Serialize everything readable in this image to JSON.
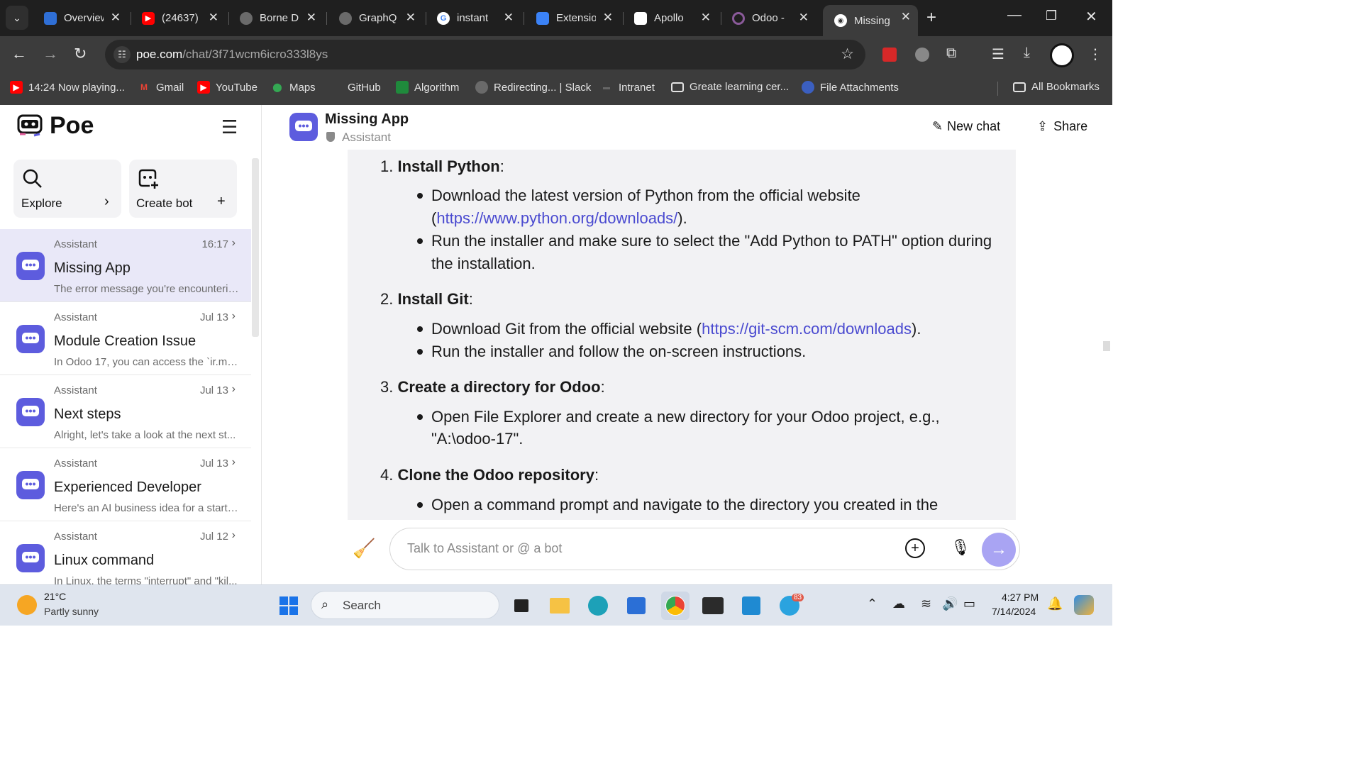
{
  "browser": {
    "tabs": [
      {
        "title": "Overview",
        "icon": "azure-devops-icon",
        "color": "#2f6fd6"
      },
      {
        "title": "(24637)",
        "icon": "youtube-icon",
        "color": "#ff0000"
      },
      {
        "title": "Borne D",
        "icon": "globe-icon",
        "color": "#7a7a7a"
      },
      {
        "title": "GraphQ",
        "icon": "globe-icon",
        "color": "#7a7a7a"
      },
      {
        "title": "instant",
        "icon": "google-icon",
        "color": "#ffffff"
      },
      {
        "title": "Extensio",
        "icon": "puzzle-icon",
        "color": "#3b82f6"
      },
      {
        "title": "Apollo",
        "icon": "apollo-icon",
        "color": "#ffffff"
      },
      {
        "title": "Odoo -",
        "icon": "odoo-icon",
        "color": "#8a5a9a"
      },
      {
        "title": "Missing",
        "icon": "poe-icon",
        "color": "#ffffff",
        "active": true
      }
    ],
    "url_domain": "poe.com",
    "url_path": "/chat/3f71wcm6icro333l8ys",
    "bookmarks": [
      {
        "label": "14:24 Now playing...",
        "icon": "youtube-icon"
      },
      {
        "label": "Gmail",
        "icon": "gmail-icon"
      },
      {
        "label": "YouTube",
        "icon": "youtube-icon"
      },
      {
        "label": "Maps",
        "icon": "maps-icon"
      },
      {
        "label": "GitHub",
        "icon": "github-icon"
      },
      {
        "label": "Algorithm",
        "icon": "algorithm-icon"
      },
      {
        "label": "Redirecting... | Slack",
        "icon": "globe-icon"
      },
      {
        "label": "Intranet",
        "icon": "intranet-icon"
      },
      {
        "label": "Greate learning cer...",
        "icon": "folder-icon"
      },
      {
        "label": "File Attachments",
        "icon": "globe-icon"
      }
    ],
    "all_bookmarks": "All Bookmarks"
  },
  "sidebar": {
    "logo": "Poe",
    "explore": "Explore",
    "create_bot": "Create bot",
    "conversations": [
      {
        "who": "Assistant",
        "time": "16:17",
        "name": "Missing App",
        "preview": "The error message you're encounterin..."
      },
      {
        "who": "Assistant",
        "time": "Jul 13",
        "name": "Module Creation Issue",
        "preview": "In Odoo 17, you can access the `ir.mo..."
      },
      {
        "who": "Assistant",
        "time": "Jul 13",
        "name": "Next steps",
        "preview": "Alright, let's take a look at the next st..."
      },
      {
        "who": "Assistant",
        "time": "Jul 13",
        "name": "Experienced Developer",
        "preview": "Here's an AI business idea for a startu..."
      },
      {
        "who": "Assistant",
        "time": "Jul 12",
        "name": "Linux command",
        "preview": "In Linux, the terms \"interrupt\" and \"kil..."
      }
    ]
  },
  "chat": {
    "title": "Missing App",
    "subtitle": "Assistant",
    "new_chat": "New chat",
    "share": "Share",
    "steps": [
      {
        "num": "1.",
        "title": "Install Python",
        "bullets": [
          {
            "lines": [
              "Download the latest version of Python from the official website",
              "(",
              "https://www.python.org/downloads/",
              ")."
            ]
          },
          {
            "lines": [
              "Run the installer and make sure to select the \"Add Python to PATH\" option during",
              "the installation."
            ]
          }
        ]
      },
      {
        "num": "2.",
        "title": "Install Git",
        "bullets": [
          {
            "lines": [
              "Download Git from the official website (",
              "https://git-scm.com/downloads",
              ")."
            ]
          },
          {
            "lines": [
              "Run the installer and follow the on-screen instructions."
            ]
          }
        ]
      },
      {
        "num": "3.",
        "title": "Create a directory for Odoo",
        "bullets": [
          {
            "lines": [
              "Open File Explorer and create a new directory for your Odoo project, e.g.,",
              "\"A:\\odoo-17\"."
            ]
          }
        ]
      },
      {
        "num": "4.",
        "title": "Clone the Odoo repository",
        "bullets": [
          {
            "lines": [
              "Open a command prompt and navigate to the directory you created in the"
            ]
          }
        ]
      }
    ],
    "input_placeholder": "Talk to Assistant or @ a bot"
  },
  "taskbar": {
    "weather_temp": "21°C",
    "weather_desc": "Partly sunny",
    "search": "Search",
    "time": "4:27 PM",
    "date": "7/14/2024",
    "telegram_badge": "83"
  },
  "colors": {
    "accent": "#5d5cde",
    "send_button": "#a9a4f3",
    "link": "#4a4ad0"
  }
}
